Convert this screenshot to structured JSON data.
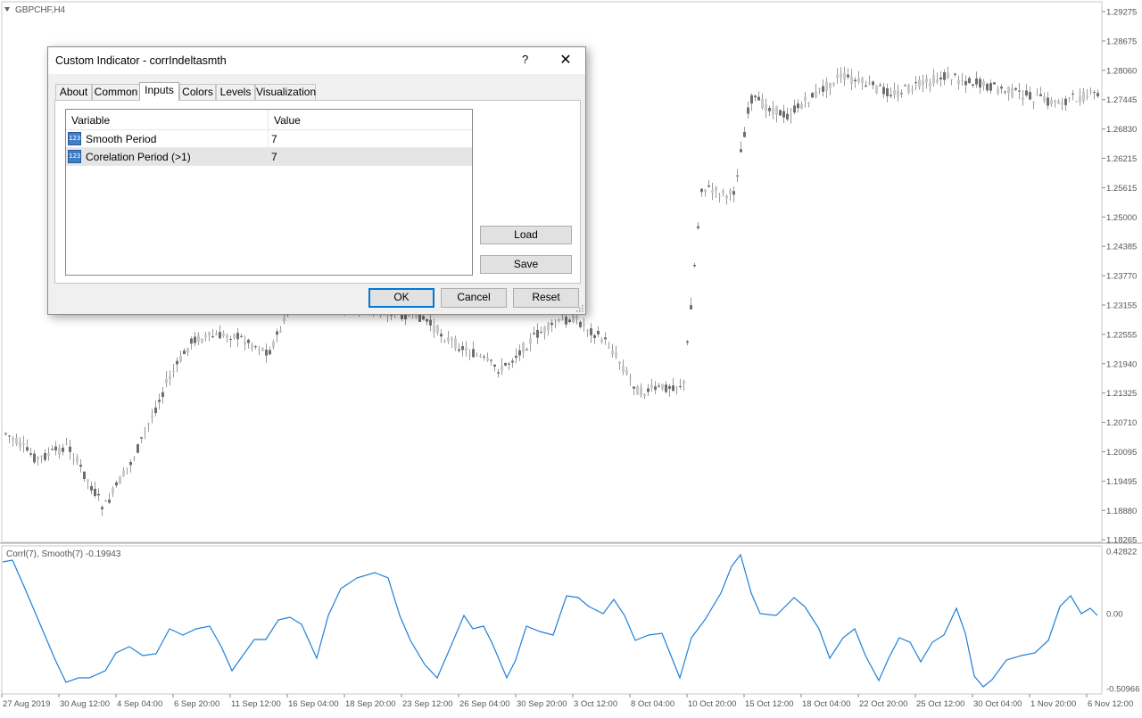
{
  "chart": {
    "symbol_label": "GBPCHF,H4",
    "indicator_label": "Corrl(7), Smooth(7) -0.19943",
    "price_labels": [
      "1.29275",
      "1.28675",
      "1.28060",
      "1.27445",
      "1.26830",
      "1.26215",
      "1.25615",
      "1.25000",
      "1.24385",
      "1.23770",
      "1.23155",
      "1.22555",
      "1.21940",
      "1.21325",
      "1.20710",
      "1.20095",
      "1.19495",
      "1.18880",
      "1.18265"
    ],
    "indicator_labels": [
      "0.42822",
      "0.00",
      "-0.50966"
    ],
    "date_labels": [
      "27 Aug 2019",
      "30 Aug 12:00",
      "4 Sep 04:00",
      "6 Sep 20:00",
      "11 Sep 12:00",
      "16 Sep 04:00",
      "18 Sep 20:00",
      "23 Sep 12:00",
      "26 Sep 04:00",
      "30 Sep 20:00",
      "3 Oct 12:00",
      "8 Oct 04:00",
      "10 Oct 20:00",
      "15 Oct 12:00",
      "18 Oct 04:00",
      "22 Oct 20:00",
      "25 Oct 12:00",
      "30 Oct 04:00",
      "1 Nov 20:00",
      "6 Nov 12:00"
    ],
    "line_color": "#1e7fd8",
    "candle_color": "#808080"
  },
  "dialog": {
    "title": "Custom Indicator - corrIndeltasmth",
    "help_label": "?",
    "close_label": "✕",
    "tabs": [
      "About",
      "Common",
      "Inputs",
      "Colors",
      "Levels",
      "Visualization"
    ],
    "active_tab": "Inputs",
    "grid": {
      "col_variable": "Variable",
      "col_value": "Value",
      "icon_text": "123",
      "rows": [
        {
          "name": "Smooth Period",
          "value": "7"
        },
        {
          "name": "Corelation Period (>1)",
          "value": "7"
        }
      ]
    },
    "load_label": "Load",
    "save_label": "Save",
    "ok_label": "OK",
    "cancel_label": "Cancel",
    "reset_label": "Reset"
  }
}
